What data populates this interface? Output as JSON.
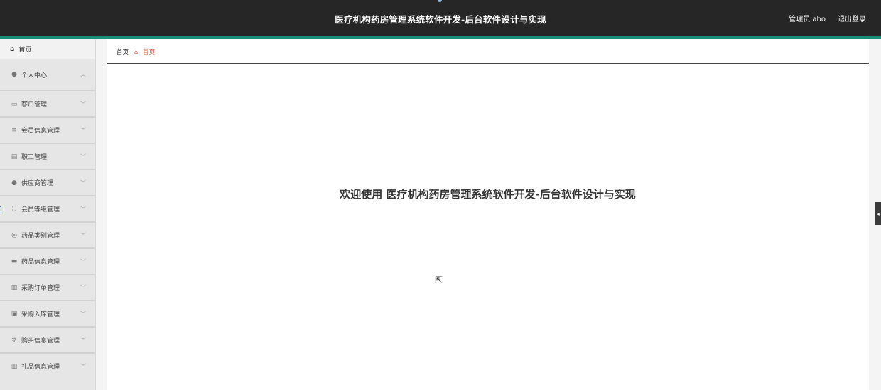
{
  "header": {
    "title": "医疗机构药房管理系统软件开发-后台软件设计与实现",
    "user": "管理员 abo",
    "logout": "退出登录"
  },
  "sidebar": {
    "home": {
      "label": "首页",
      "icon": "home-icon"
    },
    "items": [
      {
        "label": "个人中心",
        "icon": "user-icon",
        "chevron": "up"
      },
      {
        "label": "客户管理",
        "icon": "chat-icon",
        "chevron": "down"
      },
      {
        "label": "会员信息管理",
        "icon": "list-icon",
        "chevron": "down"
      },
      {
        "label": "职工管理",
        "icon": "briefcase-icon",
        "chevron": "down"
      },
      {
        "label": "供应商管理",
        "icon": "person-icon",
        "chevron": "down"
      },
      {
        "label": "会员等级管理",
        "icon": "expand-icon",
        "chevron": "down"
      },
      {
        "label": "药品类别管理",
        "icon": "compass-icon",
        "chevron": "down"
      },
      {
        "label": "药品信息管理",
        "icon": "monitor-icon",
        "chevron": "down"
      },
      {
        "label": "采购订单管理",
        "icon": "clipboard-icon",
        "chevron": "down"
      },
      {
        "label": "采购入库管理",
        "icon": "tray-icon",
        "chevron": "down"
      },
      {
        "label": "购买信息管理",
        "icon": "gear-icon",
        "chevron": "down"
      },
      {
        "label": "礼品信息管理",
        "icon": "clipboard-icon",
        "chevron": "down"
      }
    ]
  },
  "breadcrumb": {
    "root": "首页",
    "current": "首页"
  },
  "main": {
    "welcome": "欢迎使用 医疗机构药房管理系统软件开发-后台软件设计与实现"
  },
  "colors": {
    "header_bg": "#262626",
    "accent": "#1a8c7a",
    "breadcrumb_active": "#e2543a",
    "sidebar_bg": "#e6e6e6"
  }
}
